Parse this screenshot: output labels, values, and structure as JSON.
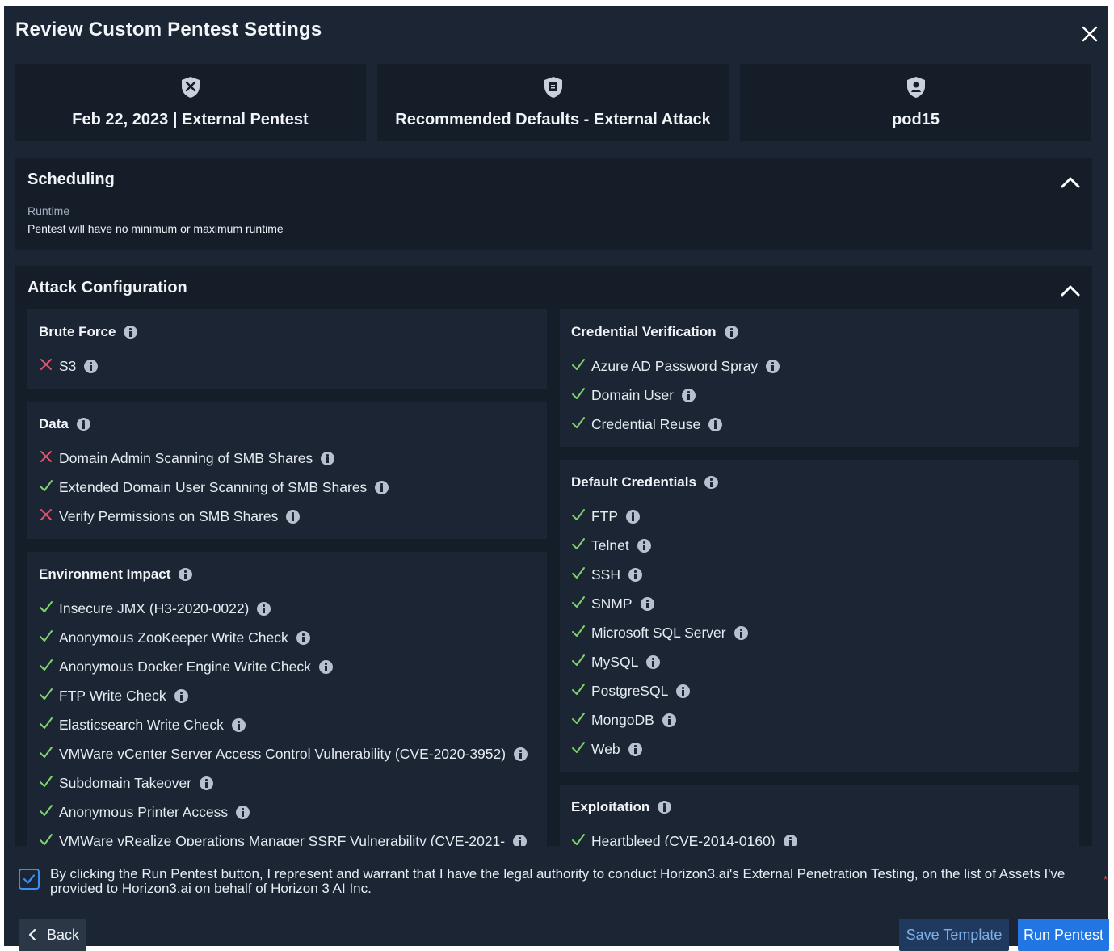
{
  "modal": {
    "title": "Review Custom Pentest Settings"
  },
  "summary_cards": [
    {
      "label": "Feb 22, 2023 | External Pentest",
      "icon": "swords-shield-icon"
    },
    {
      "label": "Recommended Defaults - External Attack",
      "icon": "document-shield-icon"
    },
    {
      "label": "pod15",
      "icon": "user-shield-icon"
    }
  ],
  "scheduling": {
    "title": "Scheduling",
    "runtime_label": "Runtime",
    "runtime_value": "Pentest will have no minimum or maximum runtime"
  },
  "attack_config": {
    "title": "Attack Configuration",
    "left_panels": [
      {
        "title": "Brute Force",
        "items": [
          {
            "label": "S3",
            "enabled": false
          }
        ]
      },
      {
        "title": "Data",
        "items": [
          {
            "label": "Domain Admin Scanning of SMB Shares",
            "enabled": false
          },
          {
            "label": "Extended Domain User Scanning of SMB Shares",
            "enabled": true
          },
          {
            "label": "Verify Permissions on SMB Shares",
            "enabled": false
          }
        ]
      },
      {
        "title": "Environment Impact",
        "items": [
          {
            "label": "Insecure JMX (H3-2020-0022)",
            "enabled": true
          },
          {
            "label": "Anonymous ZooKeeper Write Check",
            "enabled": true
          },
          {
            "label": "Anonymous Docker Engine Write Check",
            "enabled": true
          },
          {
            "label": "FTP Write Check",
            "enabled": true
          },
          {
            "label": "Elasticsearch Write Check",
            "enabled": true
          },
          {
            "label": "VMWare vCenter Server Access Control Vulnerability (CVE-2020-3952)",
            "enabled": true
          },
          {
            "label": "Subdomain Takeover",
            "enabled": true
          },
          {
            "label": "Anonymous Printer Access",
            "enabled": true
          },
          {
            "label": "VMWare vRealize Operations Manager SSRF Vulnerability (CVE-2021-",
            "enabled": true
          }
        ]
      }
    ],
    "right_panels": [
      {
        "title": "Credential Verification",
        "items": [
          {
            "label": "Azure AD Password Spray",
            "enabled": true
          },
          {
            "label": "Domain User",
            "enabled": true
          },
          {
            "label": "Credential Reuse",
            "enabled": true
          }
        ]
      },
      {
        "title": "Default Credentials",
        "items": [
          {
            "label": "FTP",
            "enabled": true
          },
          {
            "label": "Telnet",
            "enabled": true
          },
          {
            "label": "SSH",
            "enabled": true
          },
          {
            "label": "SNMP",
            "enabled": true
          },
          {
            "label": "Microsoft SQL Server",
            "enabled": true
          },
          {
            "label": "MySQL",
            "enabled": true
          },
          {
            "label": "PostgreSQL",
            "enabled": true
          },
          {
            "label": "MongoDB",
            "enabled": true
          },
          {
            "label": "Web",
            "enabled": true
          }
        ]
      },
      {
        "title": "Exploitation",
        "items": [
          {
            "label": "Heartbleed (CVE-2014-0160)",
            "enabled": true
          }
        ]
      }
    ]
  },
  "consent": {
    "checked": true,
    "text": "By clicking the Run Pentest button, I represent and warrant that I have the legal authority to conduct Horizon3.ai's External Penetration Testing, on the list of Assets I've provided to Horizon3.ai on behalf of Horizon 3 AI Inc.",
    "required_mark": "*"
  },
  "footer": {
    "back_label": "Back",
    "save_template_label": "Save Template",
    "run_pentest_label": "Run Pentest"
  },
  "colors": {
    "background": "#1b2533",
    "panel": "#151d29",
    "check": "#7fd36d",
    "cross": "#e2536b",
    "primary": "#2176e3"
  }
}
